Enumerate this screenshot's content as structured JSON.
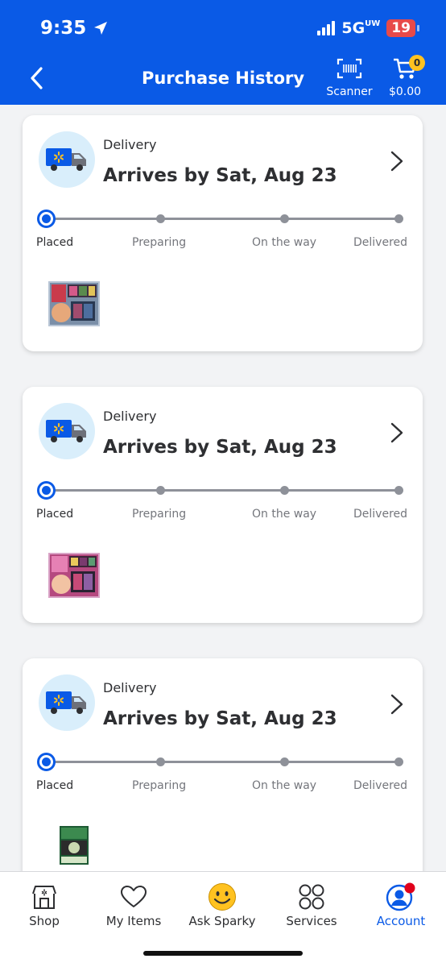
{
  "status_bar": {
    "time": "9:35",
    "network": "5G",
    "network_suffix": "UW",
    "battery": "19"
  },
  "header": {
    "title": "Purchase History",
    "scanner_label": "Scanner",
    "cart_count": "0",
    "cart_total": "$0.00"
  },
  "orders": [
    {
      "method": "Delivery",
      "arrival": "Arrives by Sat, Aug 23",
      "steps": [
        "Placed",
        "Preparing",
        "On the way",
        "Delivered"
      ],
      "current_step": "Placed"
    },
    {
      "method": "Delivery",
      "arrival": "Arrives by Sat, Aug 23",
      "steps": [
        "Placed",
        "Preparing",
        "On the way",
        "Delivered"
      ],
      "current_step": "Placed"
    },
    {
      "method": "Delivery",
      "arrival": "Arrives by Sat, Aug 23",
      "steps": [
        "Placed",
        "Preparing",
        "On the way",
        "Delivered"
      ],
      "current_step": "Placed"
    }
  ],
  "tabs": [
    {
      "label": "Shop",
      "icon": "store-icon"
    },
    {
      "label": "My Items",
      "icon": "heart-icon"
    },
    {
      "label": "Ask Sparky",
      "icon": "smiley-icon"
    },
    {
      "label": "Services",
      "icon": "grid-circles-icon"
    },
    {
      "label": "Account",
      "icon": "account-icon"
    }
  ],
  "active_tab": "Account",
  "colors": {
    "brand_blue": "#0a5ae6",
    "cart_badge": "#ffc220",
    "battery_low": "#e74a4a",
    "notification_dot": "#e0001b"
  }
}
